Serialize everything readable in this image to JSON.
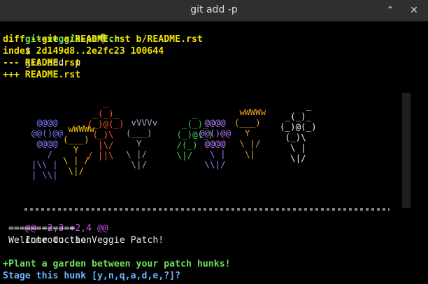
{
  "window": {
    "title": "git add -p",
    "minimize_symbol": "⌃",
    "close_symbol": "✕"
  },
  "terminal": {
    "prompt_user": "git-veggie-pa🌳ch",
    "prompt_symbol": "$",
    "command": "git add -p",
    "diff_header": "diff --git a/README.rst b/README.rst",
    "index_line": "index 2d149d8..2e2fc23 100644",
    "minus_file": "--- README.rst",
    "plus_file": "+++ README.rst",
    "hunk_header": "@@ -2,3 +2,4 @@",
    "hunk_context": "Introduction",
    "context_line_1": " ============",
    "context_line_2": " Welcome to the Veggie Patch!",
    "added_line": "+Plant a garden between your patch hunks!",
    "stage_prompt": "Stage this hunk [y,n,q,a,d,e,?]?"
  },
  "garden": {
    "plants": [
      {
        "art": " @@@@\n@@()@@\n @@@@\n   /\n|\\\\ |\n| \\\\|",
        "color": "#7a7cff"
      },
      {
        "art": "\n wWWWw\n(___)\n  Y\n\\ | /\n \\|/",
        "color": "#f2c300"
      },
      {
        "art": "   _\n _(_)_\n(_)@(_)\n (_)\\\n  |\\/\n/ ||\\",
        "color": "#ff5a2f"
      },
      {
        "art": " vVVVv\n(___)\n  Y\n\\ |/\n \\|/",
        "color": "#9aa7bf"
      },
      {
        "art": "    _\n  _(_)_\n (_)@(_)\n /(_)\n \\|/",
        "color": "#3ccf4e"
      },
      {
        "art": " @@@@\n@@()@@\n @@@@\n  \\ |\n \\\\|/",
        "color": "#b07cff"
      },
      {
        "art": " wWWWw\n(___)\n  Y\n \\ |/\n  \\|",
        "color": "#e89a23"
      },
      {
        "art": "     _\n _(_)_\n(_)@(_)\n (_)\\\n  \\ |\n  \\|/",
        "color": "#f3f3f3"
      }
    ],
    "ground": "^^^^^^^^^^^^^^^^^^^^^^^^^^^^^^^^^^^^^^^^^^^^^^^^^^^^^^^^^^^^^^^^"
  }
}
